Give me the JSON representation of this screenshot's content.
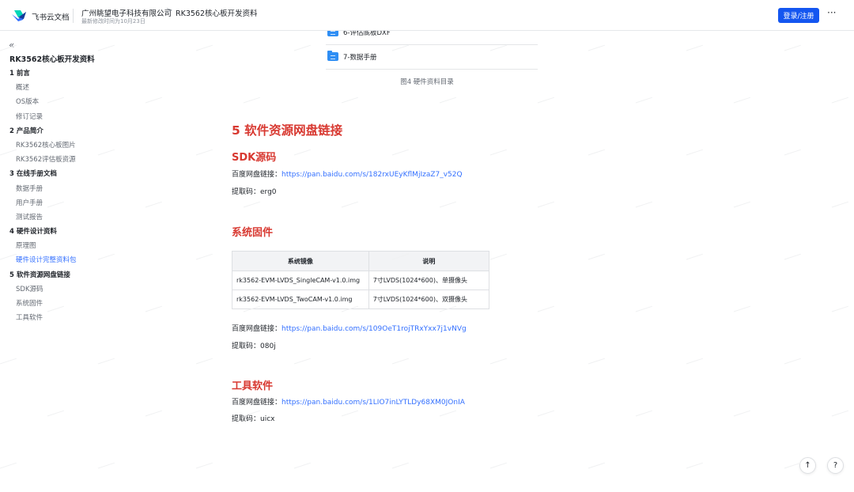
{
  "header": {
    "brand": "飞书云文档",
    "breadcrumb_org": "广州眺望电子科技有限公司",
    "breadcrumb_sep": ">",
    "breadcrumb_doc": "RK3562核心板开发资料",
    "last_modified": "最新修改时间为10月23日",
    "login_label": "登录/注册",
    "more_label": "···"
  },
  "sidebar": {
    "collapse_label": "«",
    "doc_title": "RK3562核心板开发资料",
    "items": [
      {
        "label": "1 前言",
        "level": 1
      },
      {
        "label": "概述",
        "level": 2
      },
      {
        "label": "OS版本",
        "level": 2
      },
      {
        "label": "修订记录",
        "level": 2
      },
      {
        "label": "2 产品简介",
        "level": 1
      },
      {
        "label": "RK3562核心板图片",
        "level": 2
      },
      {
        "label": "RK3562评估板资源",
        "level": 2
      },
      {
        "label": "3 在线手册文档",
        "level": 1
      },
      {
        "label": "数据手册",
        "level": 2
      },
      {
        "label": "用户手册",
        "level": 2
      },
      {
        "label": "测试报告",
        "level": 2
      },
      {
        "label": "4 硬件设计资料",
        "level": 1
      },
      {
        "label": "原理图",
        "level": 2
      },
      {
        "label": "硬件设计完整资料包",
        "level": 2,
        "active": true
      },
      {
        "label": "5 软件资源网盘链接",
        "level": 1
      },
      {
        "label": "SDK源码",
        "level": 2
      },
      {
        "label": "系统固件",
        "level": 2
      },
      {
        "label": "工具软件",
        "level": 2
      }
    ]
  },
  "content": {
    "files": [
      "6-评估底板DXF",
      "7-数据手册"
    ],
    "figure_caption": "图4 硬件资料目录",
    "section_title": "5 软件资源网盘链接",
    "sdk": {
      "title": "SDK源码",
      "link_label": "百度网盘链接：",
      "link": "https://pan.baidu.com/s/182rxUEyKflMjIzaZ7_v52Q",
      "code": "提取码：erg0"
    },
    "firmware": {
      "title": "系统固件",
      "table_headers": [
        "系统镜像",
        "说明"
      ],
      "table_rows": [
        [
          "rk3562-EVM-LVDS_SingleCAM-v1.0.img",
          "7寸LVDS(1024*600)、单摄像头"
        ],
        [
          "rk3562-EVM-LVDS_TwoCAM-v1.0.img",
          "7寸LVDS(1024*600)、双摄像头"
        ]
      ],
      "link_label": "百度网盘链接：",
      "link": "https://pan.baidu.com/s/109OeT1rojTRxYxx7j1vNVg",
      "code": "提取码：080j"
    },
    "tools": {
      "title": "工具软件",
      "link_label": "百度网盘链接：",
      "link": "https://pan.baidu.com/s/1LIO7inLYTLDy68XM0JOnIA",
      "code": "提取码：uicx"
    }
  },
  "floating": {
    "up_label": "↑",
    "help_label": "?"
  },
  "colors": {
    "accent": "#3370ff",
    "button": "#1456f0",
    "heading": "#d83931"
  }
}
